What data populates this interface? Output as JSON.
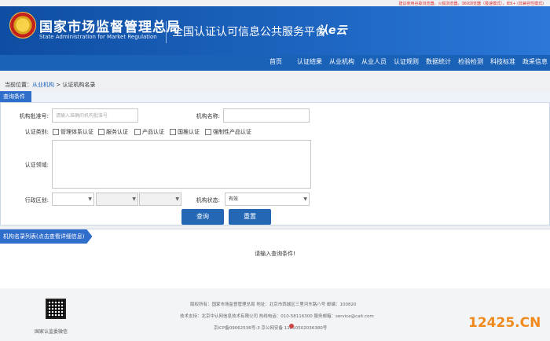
{
  "top_note": "建议使用谷歌浏览器，火狐浏览器，360浏览器（极速模式），IE9+ (非兼容性模式)",
  "header": {
    "agency_cn": "国家市场监督管理总局",
    "agency_en": "State Administration for Market Regulation",
    "platform": "全国认证认可信息公共服务平台",
    "logo2": "认e云"
  },
  "nav": [
    "首页",
    "认证结果",
    "从业机构",
    "从业人员",
    "认证规则",
    "数据统计",
    "检验检测",
    "科技标准",
    "政采信息"
  ],
  "breadcrumb": {
    "prefix": "当前位置：",
    "link": "从业机构",
    "sep": " > ",
    "current": "认证机构名录"
  },
  "query": {
    "title": "查询条件",
    "approval_label": "机构批准号:",
    "approval_placeholder": "请输入准确的机构批准号",
    "name_label": "机构名称:",
    "name_value": "",
    "category_label": "认证类别:",
    "categories": [
      "管理体系认证",
      "服务认证",
      "产品认证",
      "国推认证",
      "强制性产品认证"
    ],
    "field_label": "认证领域:",
    "region_label": "行政区划:",
    "status_label": "机构状态:",
    "status_value": "有效",
    "query_button": "查询",
    "reset_button": "重置"
  },
  "list": {
    "title": "机构名录列表(点击查看详细信息)",
    "empty": "请输入查询条件!"
  },
  "footer": {
    "qr_label": "国家认监委微信",
    "line1": "版权所有：国家市场监督管理总局    地址：北京市西城区三里河东路八号    邮编：100820",
    "line2": "技术支持：北京中认网信息技术有限公司    热线电话：010-58116300    服务邮箱：service@cait.com",
    "line3": "京ICP备09062536号-3    京公网安备    11010502036380号"
  },
  "watermark": "12425.CN"
}
